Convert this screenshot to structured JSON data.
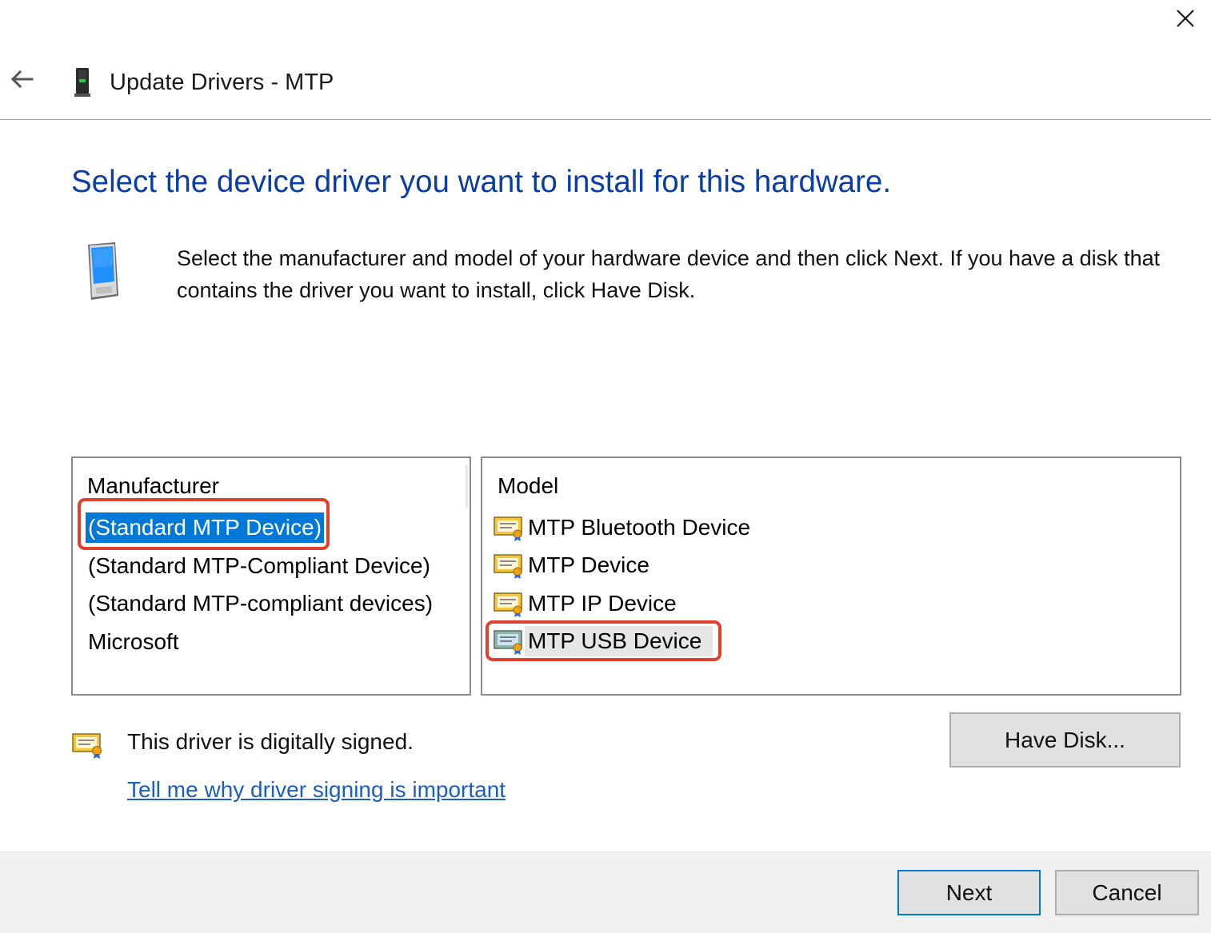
{
  "window": {
    "title": "Update Drivers - MTP",
    "close_icon": "close-icon",
    "back_icon": "back-arrow-icon",
    "device_icon": "mtp-device-icon"
  },
  "main": {
    "heading": "Select the device driver you want to install for this hardware.",
    "description": "Select the manufacturer and model of your hardware device and then click Next. If you have a disk that contains the driver you want to install, click Have Disk.",
    "illustration_icon": "phone-icon"
  },
  "manufacturer": {
    "header": "Manufacturer",
    "items": [
      "(Standard MTP Device)",
      "(Standard MTP-Compliant Device)",
      "(Standard MTP-compliant devices)",
      "Microsoft"
    ],
    "selected": "(Standard MTP Device)"
  },
  "model": {
    "header": "Model",
    "items": [
      "MTP Bluetooth Device",
      "MTP Device",
      "MTP IP Device",
      "MTP USB Device"
    ],
    "selected": "MTP USB Device",
    "item_icon": "certificate-icon"
  },
  "signing": {
    "status": "This driver is digitally signed.",
    "link": "Tell me why driver signing is important",
    "icon": "signed-certificate-icon"
  },
  "buttons": {
    "have_disk": "Have Disk...",
    "next": "Next",
    "cancel": "Cancel"
  },
  "colors": {
    "heading": "#0a3ea5",
    "selection": "#0078d7",
    "link": "#1a5fc0",
    "annotation": "#e0412c"
  }
}
